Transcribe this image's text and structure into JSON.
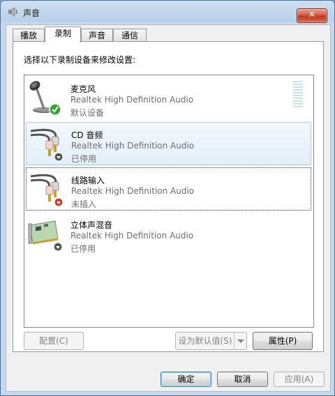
{
  "window": {
    "title": "声音",
    "close_symbol": "✕"
  },
  "tabs": [
    {
      "label": "播放",
      "active": false
    },
    {
      "label": "录制",
      "active": true
    },
    {
      "label": "声音",
      "active": false
    },
    {
      "label": "通信",
      "active": false
    }
  ],
  "instruction": "选择以下录制设备来修改设置:",
  "devices": [
    {
      "name": "麦克风",
      "driver": "Realtek High Definition Audio",
      "status": "默认设备",
      "icon": "microphone-icon",
      "badge": "default-check-icon"
    },
    {
      "name": "CD 音频",
      "driver": "Realtek High Definition Audio",
      "status": "已停用",
      "icon": "audio-cable-icon",
      "badge": "disabled-arrow-icon"
    },
    {
      "name": "线路输入",
      "driver": "Realtek High Definition Audio",
      "status": "未插入",
      "icon": "audio-cable-icon",
      "badge": "unplugged-arrow-icon"
    },
    {
      "name": "立体声混音",
      "driver": "Realtek High Definition Audio",
      "status": "已停用",
      "icon": "sound-card-icon",
      "badge": "disabled-arrow-icon"
    }
  ],
  "buttons": {
    "configure": "配置(C)",
    "set_default": "设为默认值(S)",
    "properties": "属性(P)",
    "ok": "确定",
    "cancel": "取消",
    "apply": "应用(A)"
  },
  "colors": {
    "title_bar": "#b9d0e8",
    "selection": "#e3eff9",
    "close_button": "#c0381f",
    "check_badge": "#2fa72a",
    "unplugged_badge": "#c83a2e"
  }
}
